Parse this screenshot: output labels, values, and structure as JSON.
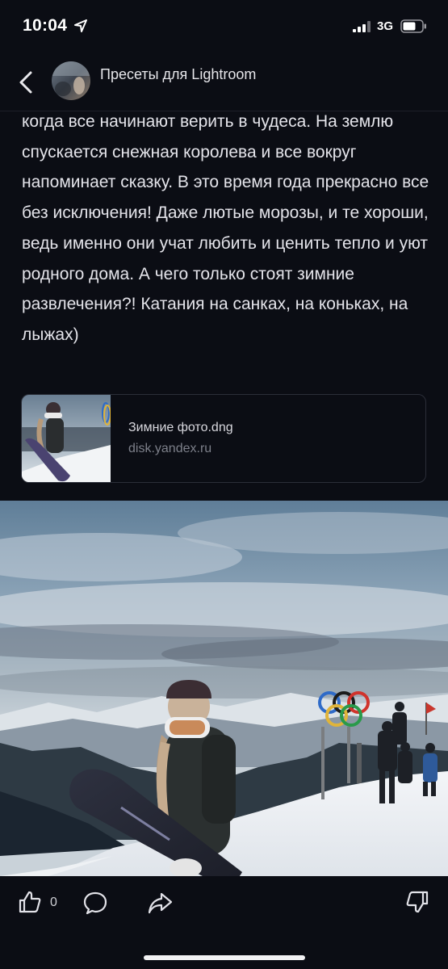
{
  "status_bar": {
    "time": "10:04",
    "network": "3G"
  },
  "header": {
    "channel_name": "Пресеты для Lightroom",
    "channel_subtitle": "",
    "back_icon": "chevron-left-icon"
  },
  "article": {
    "text": "когда все начинают верить в чудеса. На землю спускается снежная королева и все вокруг напоминает сказку. В это время года прекрасно все без исключения! Даже лютые морозы, и те хороши, ведь именно они учат любить и ценить тепло и уют родного дома. А чего только стоят зимние развлечения?! Катания на санках, на коньках, на лыжах)"
  },
  "link_card": {
    "title": "Зимние фото.dng",
    "url": "disk.yandex.ru"
  },
  "actions": {
    "like_count": "0",
    "icons": [
      "thumbs-up-icon",
      "comment-icon",
      "share-icon",
      "thumbs-down-icon"
    ]
  },
  "colors": {
    "background": "#0b0d14",
    "text": "#e4e4ea",
    "muted": "#7d808a",
    "card_border": "#2b2e38"
  }
}
